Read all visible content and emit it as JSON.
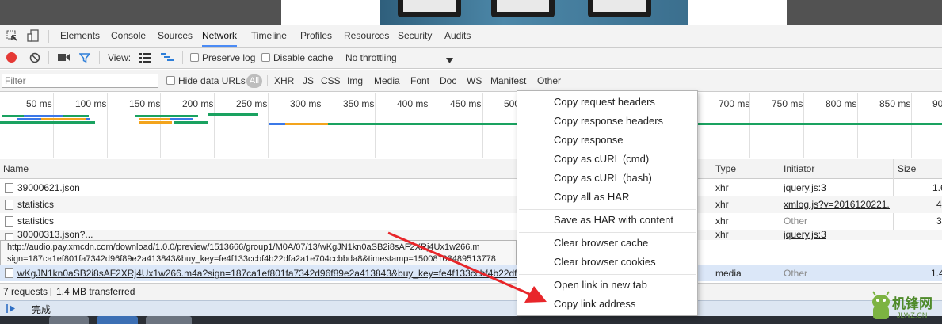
{
  "devtools": {
    "tabs": [
      "Elements",
      "Console",
      "Sources",
      "Network",
      "Timeline",
      "Profiles",
      "Resources",
      "Security",
      "Audits"
    ],
    "active_tab": "Network"
  },
  "toolbar": {
    "view_label": "View:",
    "preserve_log": "Preserve log",
    "disable_cache": "Disable cache",
    "throttling": "No throttling",
    "record_color": "#e53935"
  },
  "filterbar": {
    "placeholder": "Filter",
    "hide_data_urls": "Hide data URLs",
    "types": [
      "All",
      "XHR",
      "JS",
      "CSS",
      "Img",
      "Media",
      "Font",
      "Doc",
      "WS",
      "Manifest",
      "Other"
    ]
  },
  "timeline": {
    "ticks": [
      "50 ms",
      "100 ms",
      "150 ms",
      "200 ms",
      "250 ms",
      "300 ms",
      "350 ms",
      "400 ms",
      "450 ms",
      "500",
      "700 ms",
      "750 ms",
      "800 ms",
      "850 ms",
      "90"
    ],
    "colors": {
      "blue": "#3b78e7",
      "orange": "#f3a41d",
      "green": "#1aa260"
    }
  },
  "table": {
    "headers": {
      "name": "Name",
      "type": "Type",
      "initiator": "Initiator",
      "size": "Size"
    },
    "rows": [
      {
        "name": "39000621.json",
        "type": "xhr",
        "initiator": "jquery.js:3",
        "size": "1.6"
      },
      {
        "name": "statistics",
        "type": "xhr",
        "initiator": "xmlog.js?v=2016120221...",
        "size": "4"
      },
      {
        "name": "statistics",
        "type": "xhr",
        "initiator": "Other",
        "size": "3"
      },
      {
        "name": "30000313.json?...",
        "type": "xhr",
        "initiator": "jquery.js:3",
        "size": ""
      },
      {
        "name": "wKgJN1kn0aSB2i8sAF2XRj4Ux1w266.m4a?sign=187ca1ef801fa7342d96f89e2a413843&buy_key=fe4f133ccbf4b22dfa2a1e7...",
        "type": "media",
        "initiator": "Other",
        "size": "1.4"
      }
    ]
  },
  "tooltip": {
    "line1": "http://audio.pay.xmcdn.com/download/1.0.0/preview/1513666/group1/M0A/07/13/wKgJN1kn0aSB2i8sAF2XRj4Ux1w266.m",
    "line2": "sign=187ca1ef801fa7342d96f89e2a413843&buy_key=fe4f133ccbf4b22dfa2a1e704ccbbda8&timestamp=15008103489513778"
  },
  "status": {
    "requests": "7 requests",
    "transferred": "1.4 MB transferred"
  },
  "drawer": {
    "label": "完成"
  },
  "context_menu": {
    "groups": [
      [
        "Copy request headers",
        "Copy response headers",
        "Copy response",
        "Copy as cURL (cmd)",
        "Copy as cURL (bash)",
        "Copy all as HAR"
      ],
      [
        "Save as HAR with content"
      ],
      [
        "Clear browser cache",
        "Clear browser cookies"
      ],
      [
        "Open link in new tab",
        "Copy link address"
      ]
    ]
  },
  "watermark": {
    "text": "机锋网",
    "sub": "JLWZ.CN"
  },
  "annotation": {
    "arrow_color": "#e8262a"
  }
}
